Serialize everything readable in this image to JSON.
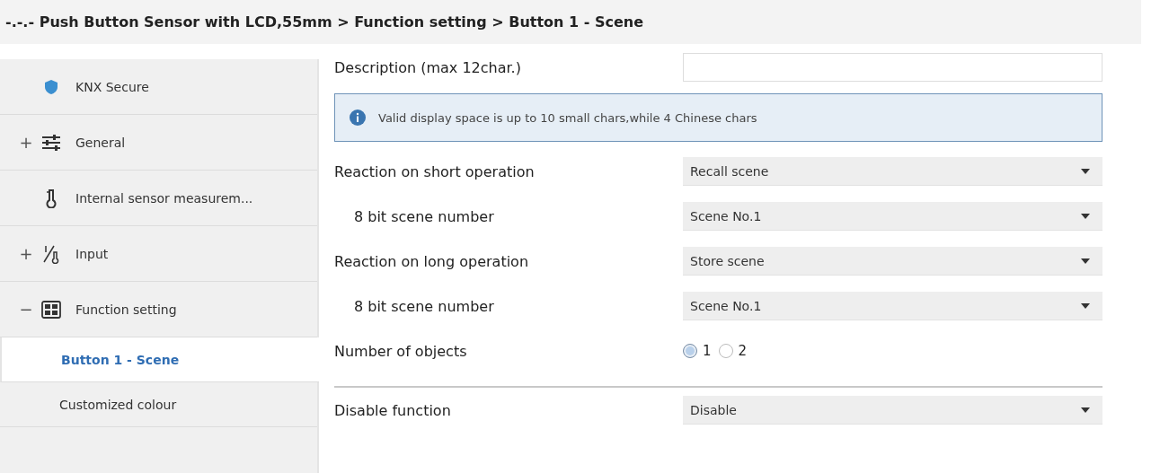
{
  "breadcrumb": "-.-.- Push Button Sensor with LCD,55mm > Function setting > Button 1 - Scene",
  "sidebar": {
    "items": [
      {
        "kind": "shield",
        "label": "KNX Secure",
        "selected": false
      },
      {
        "kind": "sliders",
        "toggle": "+",
        "label": "General",
        "selected": false
      },
      {
        "kind": "thermometer",
        "label": "Internal sensor measurem...",
        "selected": false
      },
      {
        "kind": "input",
        "toggle": "+",
        "label": "Input",
        "selected": false
      },
      {
        "kind": "grid",
        "toggle": "−",
        "label": "Function setting",
        "selected": false,
        "children": [
          {
            "label": "Button 1 - Scene",
            "selected": true
          },
          {
            "label": "Customized colour",
            "selected": false
          }
        ]
      }
    ]
  },
  "parameters": [
    {
      "kind": "text",
      "label": "Description (max 12char.)"
    },
    {
      "kind": "info",
      "text": "Valid display space is up to 10 small chars,while 4 Chinese chars"
    },
    {
      "kind": "select",
      "label": "Reaction on short operation",
      "value": "Recall scene",
      "children": [
        {
          "kind": "select",
          "label": "8 bit scene number",
          "value": "Scene No.1"
        }
      ]
    },
    {
      "kind": "select",
      "label": "Reaction on long operation",
      "value": "Store scene",
      "children": [
        {
          "kind": "select",
          "label": "8 bit scene number",
          "value": "Scene No.1"
        }
      ]
    },
    {
      "kind": "radio",
      "label": "Number of objects",
      "options": [
        {
          "label": "1",
          "selected": true
        },
        {
          "label": "2",
          "selected": false
        }
      ]
    },
    {
      "kind": "divider"
    },
    {
      "kind": "select",
      "label": "Disable function",
      "value": "Disable"
    }
  ]
}
